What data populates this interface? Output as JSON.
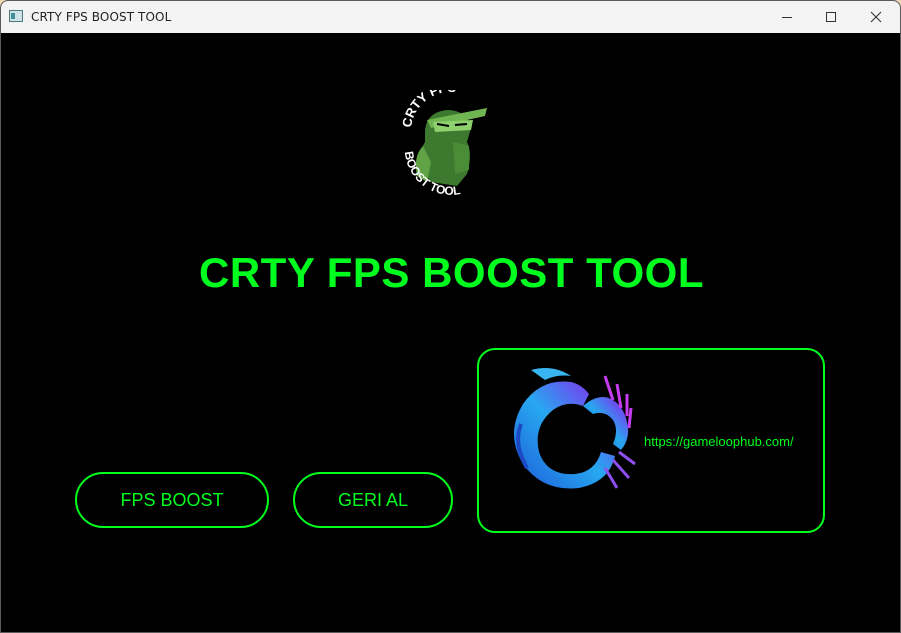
{
  "window": {
    "title": "CRTY FPS BOOST TOOL",
    "controls": {
      "minimize": "minimize",
      "maximize": "maximize",
      "close": "close"
    }
  },
  "logo": {
    "top_text": "CRTY FPS",
    "bottom_text": "BOOST TOOL",
    "icon": "ninja-logo"
  },
  "heading": "CRTY FPS BOOST TOOL",
  "buttons": {
    "fps_boost": "FPS BOOST",
    "geri_al": "GERI AL"
  },
  "promo": {
    "link": "https://gameloophub.com/",
    "icon": "dragon-logo-icon"
  },
  "colors": {
    "accent": "#00ff1e",
    "background": "#000000",
    "titlebar": "#f3f3f3"
  }
}
